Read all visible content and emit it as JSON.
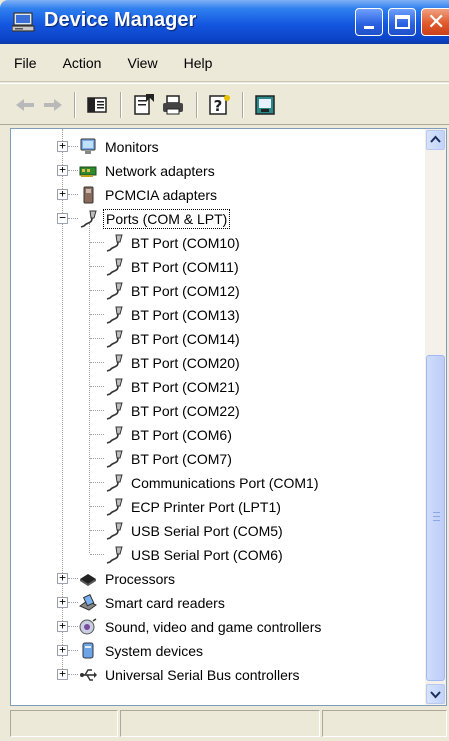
{
  "window": {
    "title": "Device Manager",
    "accent": "#0b43c6"
  },
  "menu": {
    "items": [
      {
        "label": "File"
      },
      {
        "label": "Action"
      },
      {
        "label": "View"
      },
      {
        "label": "Help"
      }
    ]
  },
  "toolbar": {
    "buttons": [
      "back-arrow-icon",
      "forward-arrow-icon",
      "console-tree-icon",
      "properties-icon",
      "print-icon",
      "help-icon",
      "scan-hardware-icon"
    ]
  },
  "tree": {
    "categories_top": [
      {
        "label": "Monitors",
        "icon": "monitor-icon"
      },
      {
        "label": "Network adapters",
        "icon": "network-adapter-icon"
      },
      {
        "label": "PCMCIA adapters",
        "icon": "pcmcia-icon"
      }
    ],
    "ports": {
      "label": "Ports (COM & LPT)",
      "icon": "port-plug-icon",
      "children": [
        {
          "label": "BT Port (COM10)"
        },
        {
          "label": "BT Port (COM11)"
        },
        {
          "label": "BT Port (COM12)"
        },
        {
          "label": "BT Port (COM13)"
        },
        {
          "label": "BT Port (COM14)"
        },
        {
          "label": "BT Port (COM20)"
        },
        {
          "label": "BT Port (COM21)"
        },
        {
          "label": "BT Port (COM22)"
        },
        {
          "label": "BT Port (COM6)"
        },
        {
          "label": "BT Port (COM7)"
        },
        {
          "label": "Communications Port (COM1)"
        },
        {
          "label": "ECP Printer Port (LPT1)"
        },
        {
          "label": "USB Serial Port (COM5)"
        },
        {
          "label": "USB Serial Port (COM6)"
        }
      ]
    },
    "categories_bottom": [
      {
        "label": "Processors",
        "icon": "processor-icon"
      },
      {
        "label": "Smart card readers",
        "icon": "smart-card-reader-icon"
      },
      {
        "label": "Sound, video and game controllers",
        "icon": "sound-icon"
      },
      {
        "label": "System devices",
        "icon": "system-devices-icon"
      },
      {
        "label": "Universal Serial Bus controllers",
        "icon": "usb-icon"
      }
    ]
  }
}
